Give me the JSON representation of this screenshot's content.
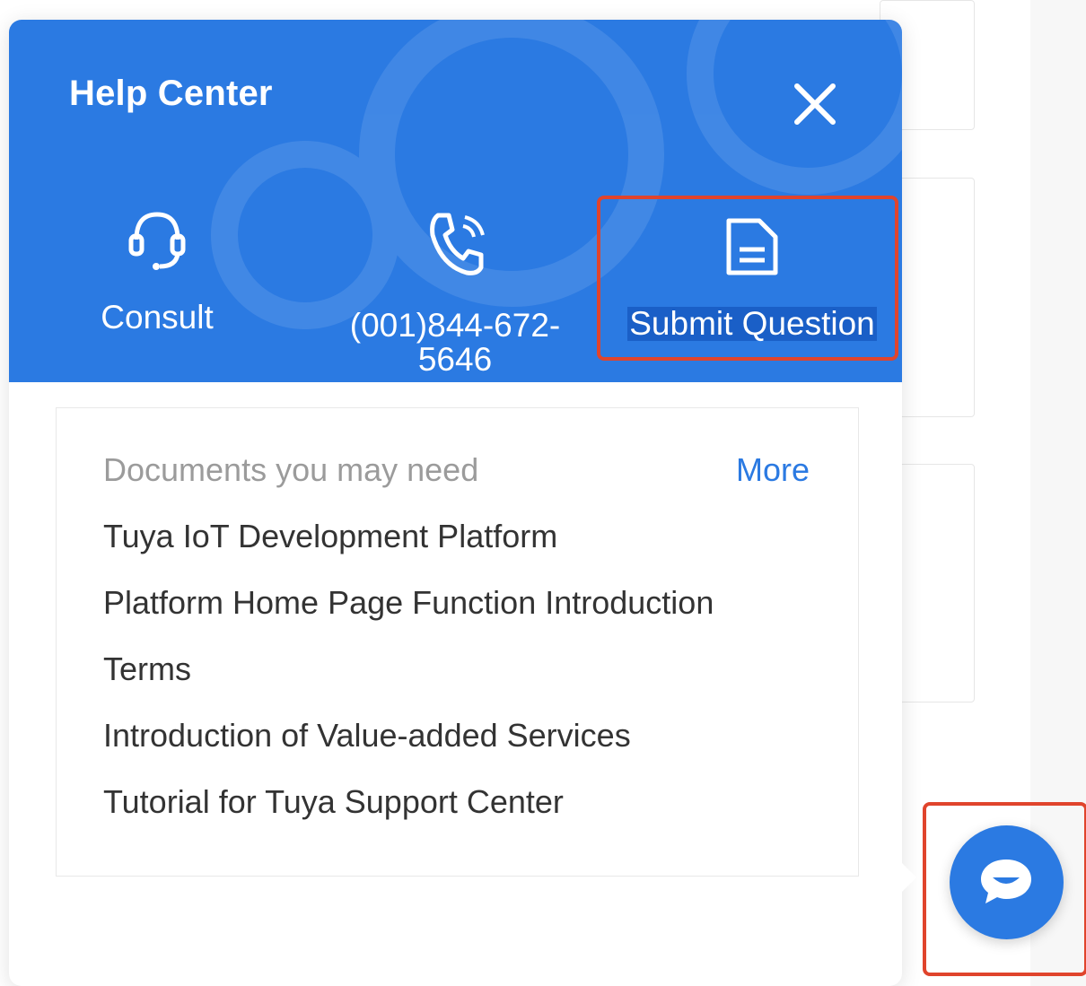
{
  "panel": {
    "title": "Help Center",
    "close_icon": "close-icon",
    "header_color": "#2b7ae2",
    "actions": [
      {
        "label": "Consult",
        "icon": "headset-icon"
      },
      {
        "label": "(001)844-672-5646",
        "icon": "phone-icon"
      },
      {
        "label": "Submit Question",
        "icon": "document-icon"
      }
    ]
  },
  "docs": {
    "heading": "Documents you may need",
    "more_label": "More",
    "items": [
      "Tuya IoT Development Platform",
      "Platform Home Page Function Introduction",
      "Terms",
      "Introduction of Value-added Services",
      "Tutorial for Tuya Support Center"
    ]
  },
  "chat_button": {
    "icon": "chat-bubble-icon"
  },
  "highlight_color": "#e0442c"
}
